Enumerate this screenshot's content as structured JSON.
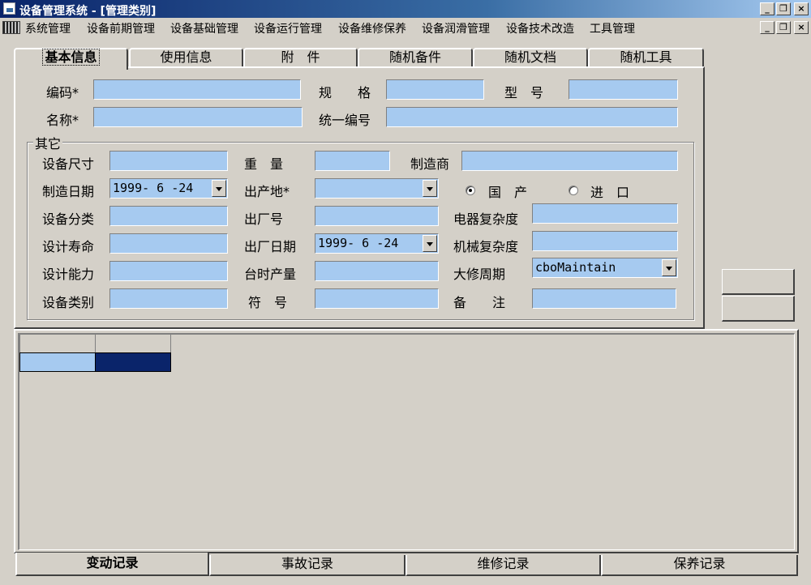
{
  "window": {
    "title": "设备管理系统 - [管理类别]",
    "title_buttons": [
      "_",
      "❐",
      "×"
    ],
    "child_buttons": [
      "_",
      "❐",
      "×"
    ]
  },
  "menu": [
    "系统管理",
    "设备前期管理",
    "设备基础管理",
    "设备运行管理",
    "设备维修保养",
    "设备润滑管理",
    "设备技术改造",
    "工具管理"
  ],
  "tabs": [
    "基本信息",
    "使用信息",
    "附　件",
    "随机备件",
    "随机文档",
    "随机工具"
  ],
  "basic": {
    "code_label": "编码*",
    "spec_label": "规　　格",
    "model_label": "型　号",
    "name_label": "名称*",
    "unified_no_label": "统一编号"
  },
  "other": {
    "group_label": "其它",
    "size_label": "设备尺寸",
    "weight_label": "重　量",
    "maker_label": "制造商",
    "make_date_label": "制造日期",
    "make_date_value": "1999- 6 -24",
    "origin_label": "出产地*",
    "domestic_label": "国　产",
    "import_label": "进　口",
    "category_label": "设备分类",
    "factory_no_label": "出厂号",
    "elec_complexity_label": "电器复杂度",
    "life_label": "设计寿命",
    "factory_date_label": "出厂日期",
    "factory_date_value": "1999- 6 -24",
    "mech_complexity_label": "机械复杂度",
    "capacity_label": "设计能力",
    "hourly_output_label": "台时产量",
    "overhaul_cycle_label": "大修周期",
    "overhaul_cycle_value": "cboMaintain",
    "type_label": "设备类别",
    "symbol_label": "符　号",
    "remark_label": "备　　注"
  },
  "bottom_tabs": [
    "变动记录",
    "事故记录",
    "维修记录",
    "保养记录"
  ],
  "colors": {
    "field": "#a6caf0",
    "selected_cell": "#0a246a",
    "face": "#d4d0c8"
  }
}
